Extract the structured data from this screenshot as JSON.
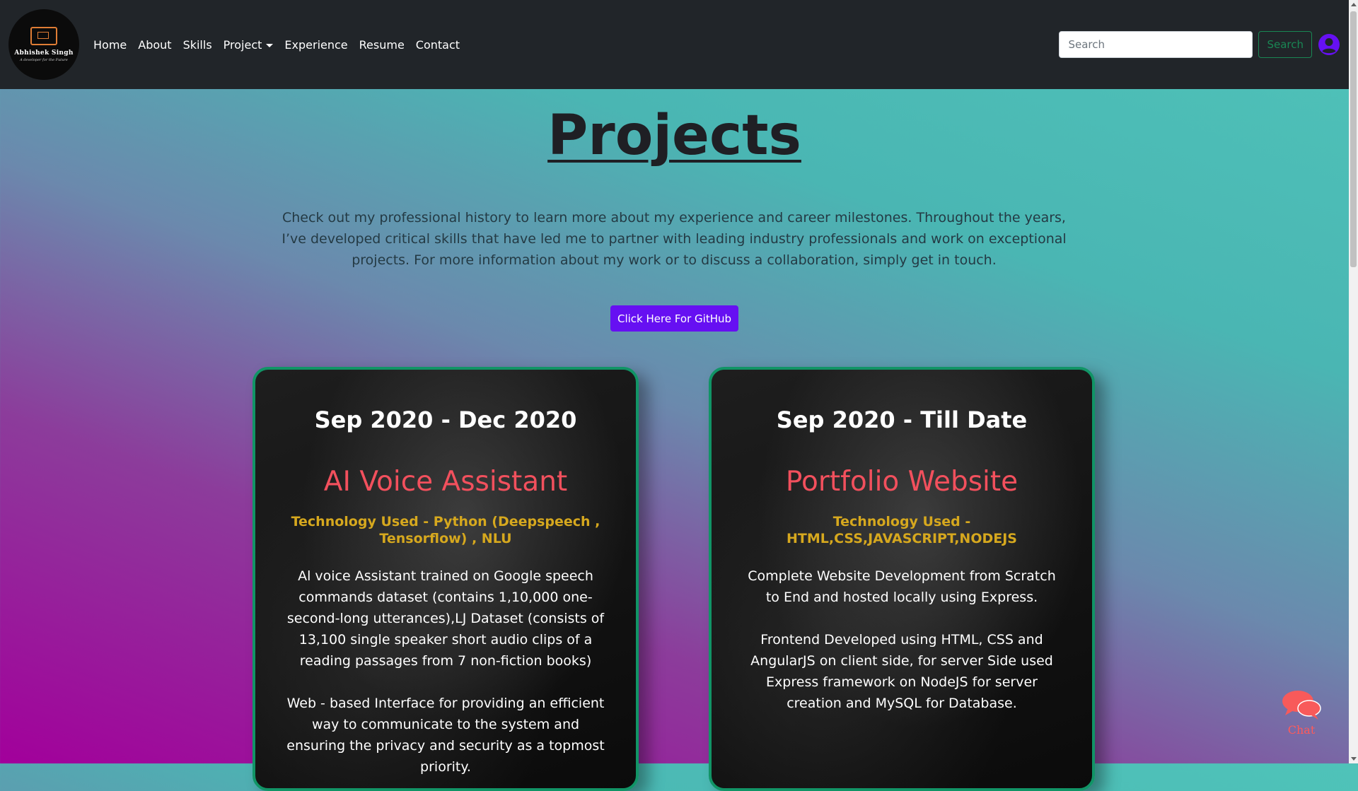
{
  "nav": {
    "logo": {
      "name": "Abhishek Singh",
      "tagline": "A developer for the Future"
    },
    "links": [
      {
        "label": "Home"
      },
      {
        "label": "About"
      },
      {
        "label": "Skills"
      },
      {
        "label": "Project"
      },
      {
        "label": "Experience"
      },
      {
        "label": "Resume"
      },
      {
        "label": "Contact"
      }
    ],
    "search": {
      "placeholder": "Search",
      "button_label": "Search"
    }
  },
  "main": {
    "title": "Projects",
    "intro": "Check out my professional history to learn more about my experience and career milestones. Throughout the years, I’ve developed critical skills that have led me to partner with leading industry professionals and work on exceptional projects. For more information about my work or to discuss a collaboration, simply get in touch.",
    "github_button": "Click Here For GitHub",
    "cards": [
      {
        "date": "Sep 2020 - Dec 2020",
        "title": "AI Voice Assistant",
        "tech": "Technology Used - Python (Deepspeech , Tensorflow) , NLU",
        "desc": [
          "Al voice Assistant trained on Google speech commands dataset (contains 1,10,000 one-second-long utterances),LJ Dataset (consists of 13,100 single speaker short audio clips of a reading passages from 7 non-fiction books)",
          "Web - based Interface for providing an efficient way to communicate to the system and ensuring the privacy and security as a topmost priority."
        ]
      },
      {
        "date": "Sep 2020 - Till Date",
        "title": "Portfolio Website",
        "tech": "Technology Used - HTML,CSS,JAVASCRIPT,NODEJS",
        "desc": [
          "Complete Website Development from Scratch to End and hosted locally using Express.",
          "Frontend Developed using HTML, CSS and AngularJS on client side, for server Side used Express framework on NodeJS for server creation and MySQL for Database."
        ]
      }
    ]
  },
  "chat": {
    "label": "Chat"
  },
  "colors": {
    "navbar": "#212529",
    "accent": "#6610f2",
    "card_border": "#119466",
    "card_title": "#f2505d",
    "card_tech": "#d6a81e",
    "search_button": "#198754"
  },
  "icons": {
    "user": "user-circle-icon",
    "chat": "chat-bubbles-icon",
    "dropdown": "caret-down-icon"
  }
}
